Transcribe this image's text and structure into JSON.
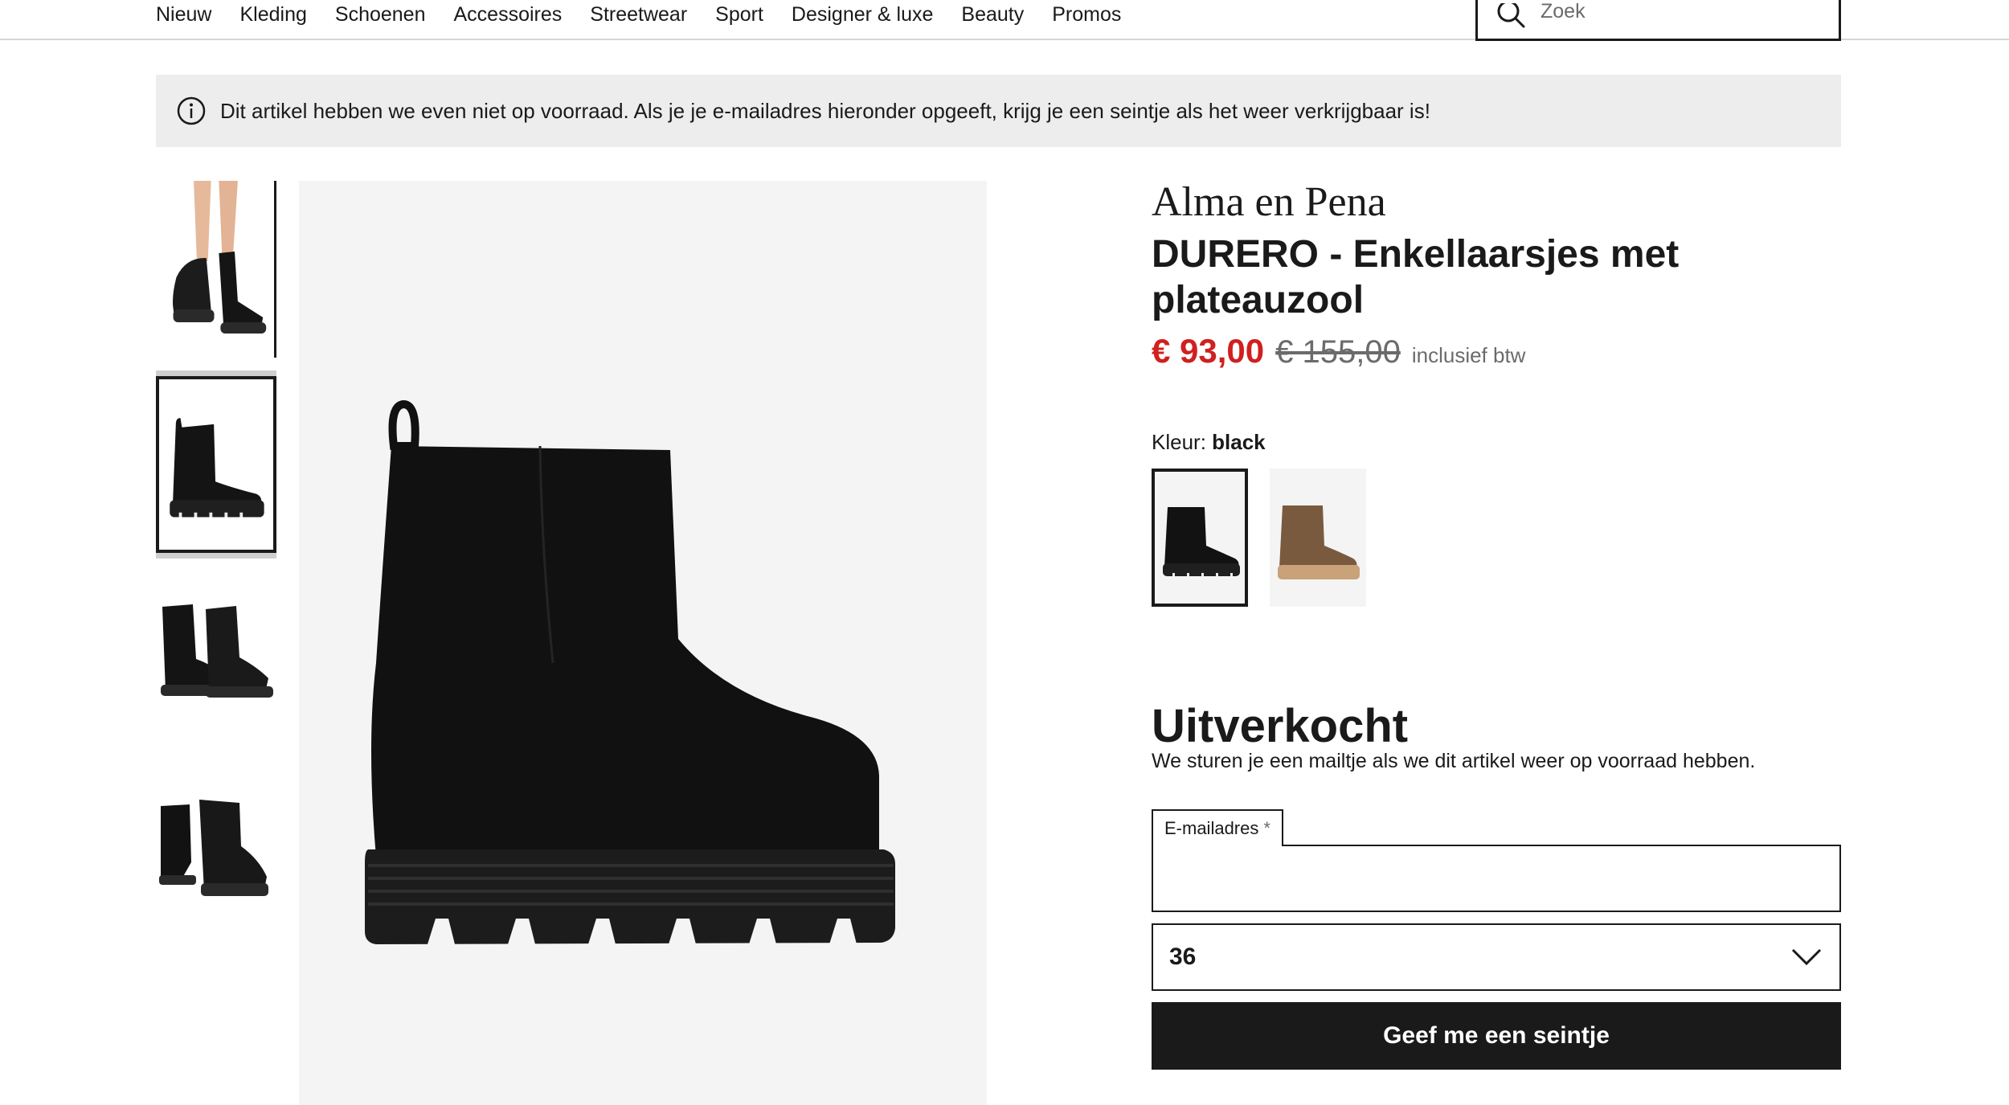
{
  "nav": {
    "items": [
      "Nieuw",
      "Kleding",
      "Schoenen",
      "Accessoires",
      "Streetwear",
      "Sport",
      "Designer & luxe",
      "Beauty",
      "Promos"
    ],
    "search_placeholder": "Zoek",
    "search_icon": "search-icon"
  },
  "banner": {
    "icon": "info-icon",
    "text": "Dit artikel hebben we even niet op voorraad. Als je je e-mailadres hieronder opgeeft, krijg je een seintje als het weer verkrijgbaar is!"
  },
  "gallery": {
    "thumbnails": [
      "worn-boots",
      "boot-side-view",
      "boot-pair-rear",
      "boot-pair-front"
    ],
    "selected_thumbnail": 2
  },
  "product": {
    "brand": "Alma en Pena",
    "title": "DURERO - Enkellaarsjes met plateauzool",
    "price_sale": "€ 93,00",
    "price_original": "€ 155,00",
    "price_note": "inclusief btw",
    "color_label": "Kleur:",
    "color_value": "black",
    "swatches": [
      "black",
      "brown"
    ]
  },
  "soldout": {
    "heading": "Uitverkocht",
    "text": "We sturen je een mailtje als we dit artikel weer op voorraad hebben.",
    "email_label": "E-mailadres",
    "email_required_mark": "*",
    "email_value": "",
    "size_value": "36",
    "button_label": "Geef me een seintje"
  },
  "colors": {
    "accent_sale": "#d0201f",
    "text": "#1a1a1a",
    "muted": "#6b6b6b",
    "banner_bg": "#ededed",
    "image_bg": "#f4f4f4"
  }
}
